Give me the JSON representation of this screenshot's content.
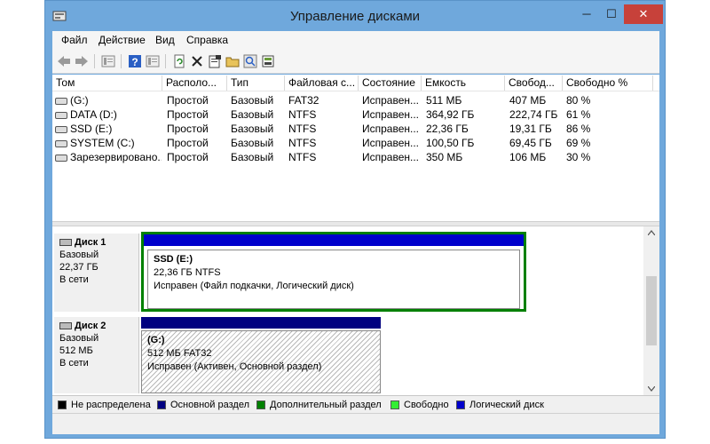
{
  "window": {
    "title": "Управление дисками",
    "minimize": "─",
    "maximize": "☐",
    "close": "✕"
  },
  "menu": [
    "Файл",
    "Действие",
    "Вид",
    "Справка"
  ],
  "toolbar_icons": [
    "back-icon",
    "forward-icon",
    "disk-list-icon",
    "help-icon",
    "properties-icon",
    "refresh-icon",
    "delete-icon",
    "properties-sheet-icon",
    "open-folder-icon",
    "search-icon",
    "export-icon"
  ],
  "columns": [
    "Том",
    "Располо...",
    "Тип",
    "Файловая с...",
    "Состояние",
    "Емкость",
    "Свобод...",
    "Свободно %"
  ],
  "volumes": [
    [
      "(G:)",
      "Простой",
      "Базовый",
      "FAT32",
      "Исправен...",
      "511 МБ",
      "407 МБ",
      "80 %"
    ],
    [
      "DATA (D:)",
      "Простой",
      "Базовый",
      "NTFS",
      "Исправен...",
      "364,92 ГБ",
      "222,74 ГБ",
      "61 %"
    ],
    [
      "SSD (E:)",
      "Простой",
      "Базовый",
      "NTFS",
      "Исправен...",
      "22,36 ГБ",
      "19,31 ГБ",
      "86 %"
    ],
    [
      "SYSTEM (C:)",
      "Простой",
      "Базовый",
      "NTFS",
      "Исправен...",
      "100,50 ГБ",
      "69,45 ГБ",
      "69 %"
    ],
    [
      "Зарезервировано...",
      "Простой",
      "Базовый",
      "NTFS",
      "Исправен...",
      "350 МБ",
      "106 МБ",
      "30 %"
    ]
  ],
  "disks": [
    {
      "name": "Диск 1",
      "type": "Базовый",
      "size": "22,37 ГБ",
      "status": "В сети",
      "volume": {
        "name": "SSD  (E:)",
        "size_fs": "22,36 ГБ NTFS",
        "health": "Исправен (Файл подкачки, Логический диск)"
      }
    },
    {
      "name": "Диск 2",
      "type": "Базовый",
      "size": "512 МБ",
      "status": "В сети",
      "volume": {
        "name": "(G:)",
        "size_fs": "512 МБ FAT32",
        "health": "Исправен (Активен, Основной раздел)"
      }
    }
  ],
  "legend": [
    {
      "label": "Не распределена",
      "color": "#000000"
    },
    {
      "label": "Основной раздел",
      "color": "#000080"
    },
    {
      "label": "Дополнительный раздел",
      "color": "#008000"
    },
    {
      "label": "Свободно",
      "color": "#33ee33"
    },
    {
      "label": "Логический диск",
      "color": "#0000cc"
    }
  ],
  "colors": {
    "titlebar": "#6fa8dc",
    "close_button": "#c7413a",
    "logical_bar": "#0000cc",
    "primary_bar": "#000080",
    "extended_border": "#008000"
  }
}
